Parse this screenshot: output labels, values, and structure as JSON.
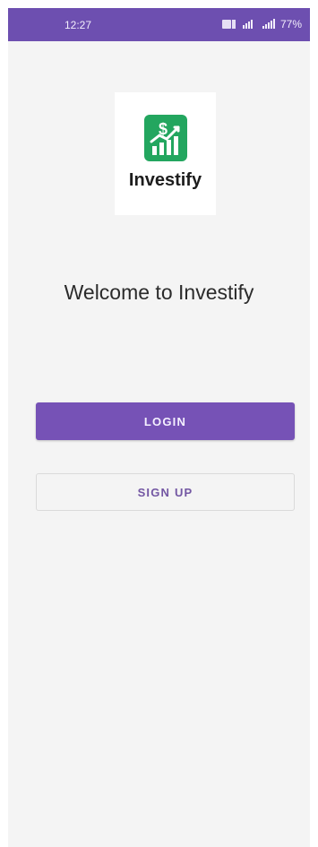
{
  "status_bar": {
    "time": "12:27",
    "battery": "77%",
    "icons": [
      "volte-icon",
      "mobile-data-icon",
      "signal-icon"
    ]
  },
  "logo": {
    "icon": "investment-growth-icon",
    "text": "Investify"
  },
  "welcome": {
    "title": "Welcome to Investify"
  },
  "actions": {
    "login_label": "LOGIN",
    "signup_label": "SIGN UP"
  },
  "colors": {
    "primary": "#6D4FB0",
    "button": "#7652B6",
    "logo_green": "#23A65F",
    "background": "#F4F4F4"
  }
}
